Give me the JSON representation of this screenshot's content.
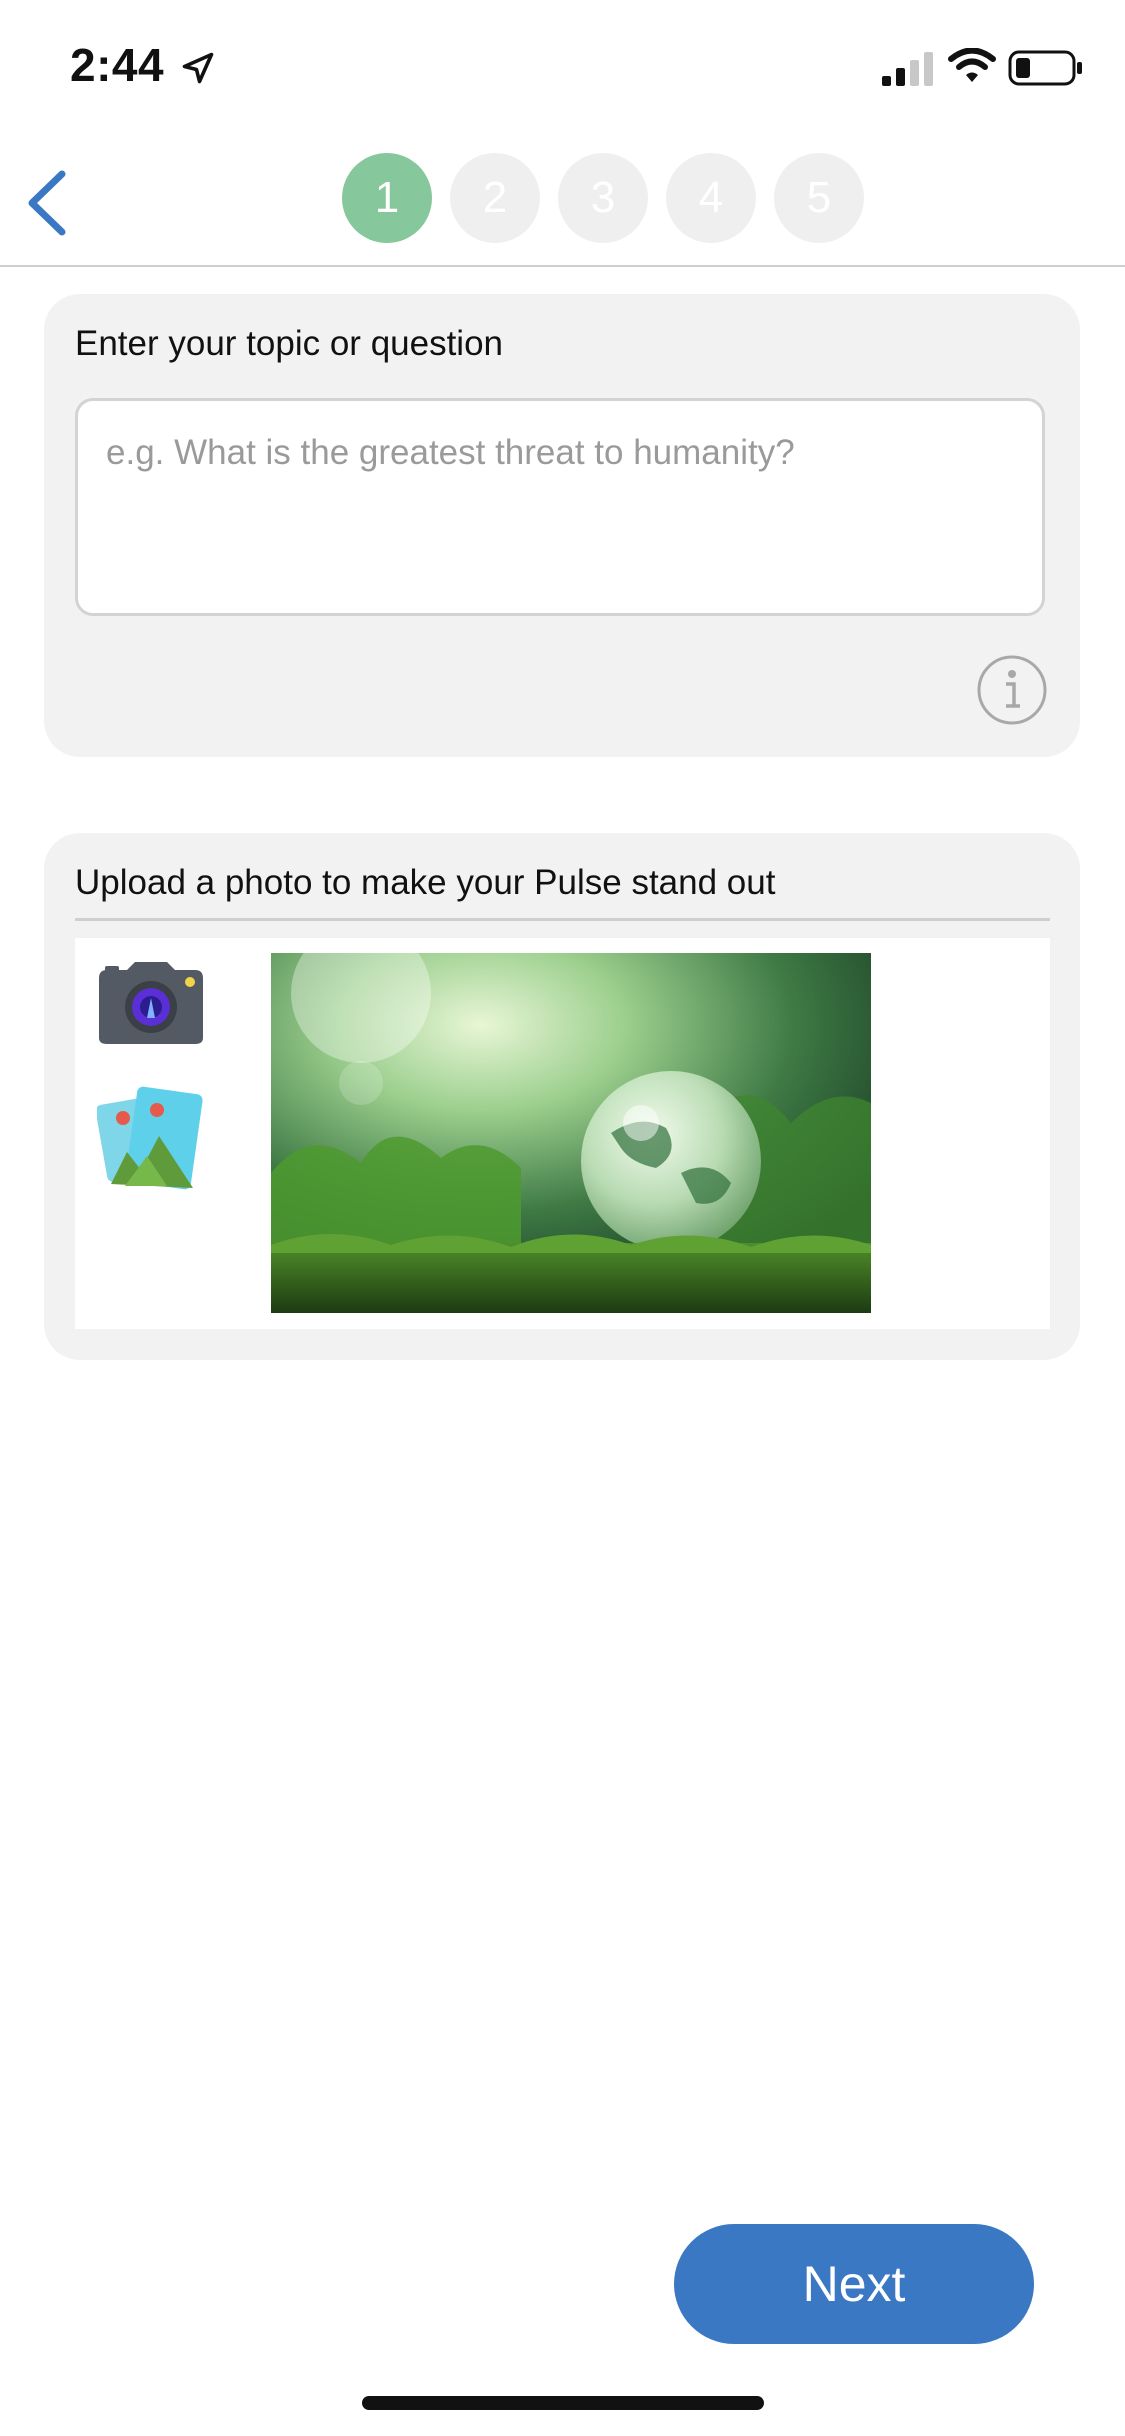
{
  "status_bar": {
    "time": "2:44",
    "icons": [
      "location-arrow-icon",
      "cellular-signal-icon",
      "wifi-icon",
      "battery-icon"
    ]
  },
  "nav": {
    "back_icon": "chevron-left-icon",
    "steps": [
      "1",
      "2",
      "3",
      "4",
      "5"
    ],
    "active_step": "1",
    "active_color": "#86c79b",
    "inactive_color": "#efefef"
  },
  "topic_card": {
    "title": "Enter your topic or question",
    "placeholder": "e.g. What is the greatest threat to humanity?",
    "info_icon": "info-icon"
  },
  "photo_card": {
    "title": "Upload a photo to make your Pulse stand out",
    "camera_icon": "camera-icon",
    "gallery_icon": "photo-gallery-icon",
    "preview_description_icon": "globe-in-moss-image"
  },
  "footer": {
    "next_label": "Next",
    "accent_color": "#3a78c4"
  }
}
